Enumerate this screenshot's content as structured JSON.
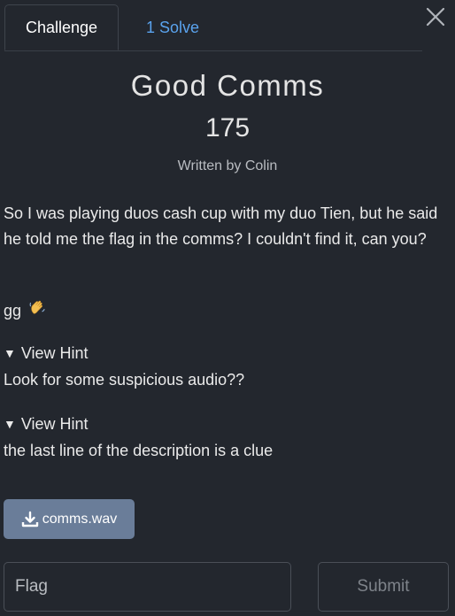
{
  "tabs": [
    {
      "label": "Challenge",
      "active": true
    },
    {
      "label": "1 Solve",
      "active": false
    }
  ],
  "challenge": {
    "name": "Good Comms",
    "points": "175",
    "author": "Written by Colin",
    "description": "So I was playing duos cash cup with my duo Tien, but he said he told me the flag in the comms? I couldn't find it, can you?",
    "extra_line": "gg",
    "extra_emoji": "waving-hand"
  },
  "hints": [
    {
      "toggle_label": "View Hint",
      "text": "Look for some suspicious audio??"
    },
    {
      "toggle_label": "View Hint",
      "text": "the last line of the description is a clue"
    }
  ],
  "file": {
    "name": "comms.wav",
    "icon": "download-icon"
  },
  "flag_form": {
    "placeholder": "Flag",
    "value": "",
    "submit_label": "Submit"
  },
  "colors": {
    "background": "#23272e",
    "tab_link": "#5aa3ee",
    "file_button": "#6a7d99",
    "muted": "#7e838a"
  }
}
